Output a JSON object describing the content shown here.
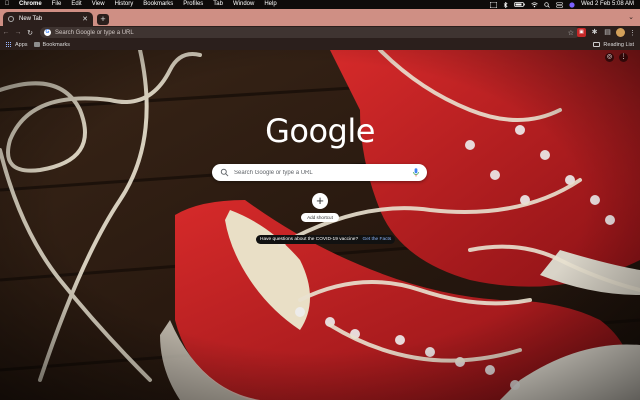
{
  "menubar": {
    "app": "Chrome",
    "items": [
      "File",
      "Edit",
      "View",
      "History",
      "Bookmarks",
      "Profiles",
      "Tab",
      "Window",
      "Help"
    ],
    "clock": "Wed 2 Feb  5:08 AM"
  },
  "tab": {
    "title": "New Tab"
  },
  "omnibox": {
    "placeholder": "Search Google or type a URL"
  },
  "bookmarks": {
    "apps_label": "Apps",
    "folder_label": "Bookmarks",
    "reading_list_label": "Reading List"
  },
  "ntp": {
    "logo_text": "Google",
    "search_placeholder": "Search Google or type a URL",
    "shortcut_label": "Add shortcut",
    "promo_text": "Have questions about the COVID-19 vaccine?",
    "promo_link": "Get the Facts"
  },
  "colors": {
    "tabstrip": "#cf8f84",
    "toolbar": "#2b1f1c",
    "shoe_red": "#b81d1f"
  },
  "icons": [
    "apple-icon",
    "wifi-icon",
    "battery-icon",
    "google-g-icon",
    "star-icon",
    "puzzle-icon",
    "mic-icon",
    "search-icon",
    "plus-icon"
  ]
}
